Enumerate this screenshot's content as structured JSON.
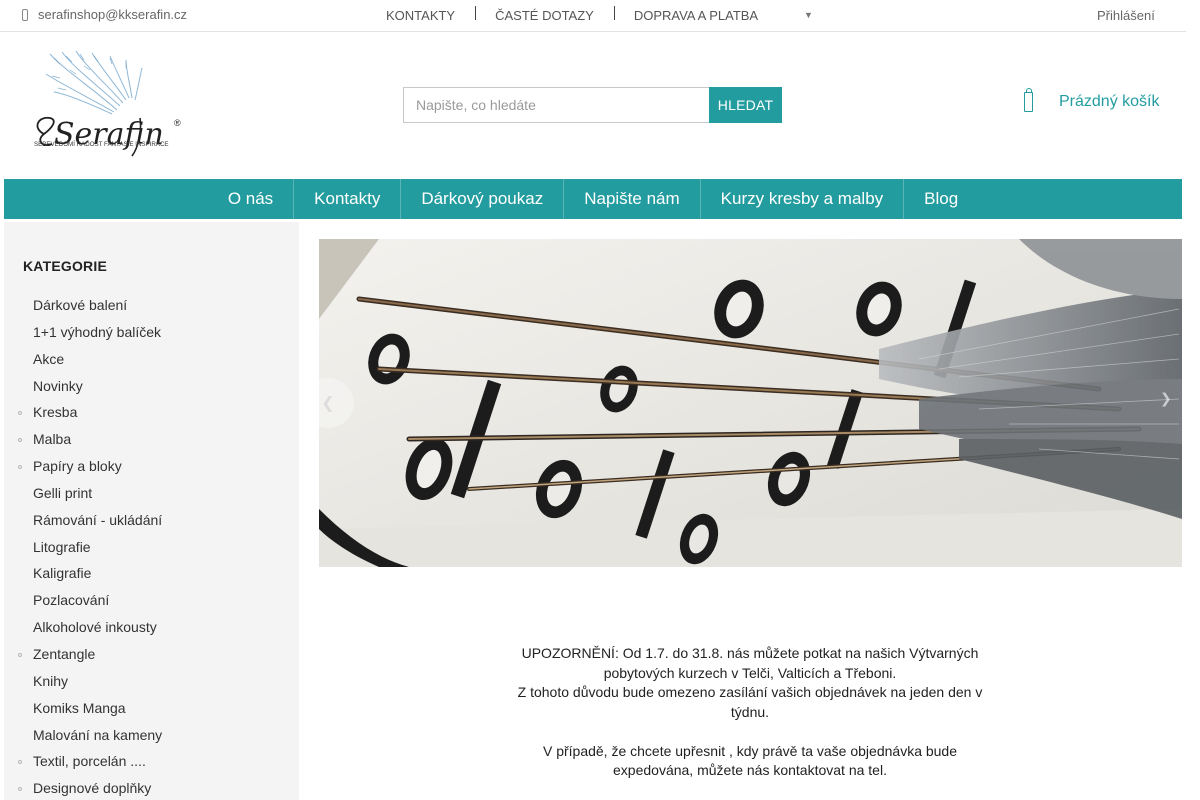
{
  "topbar": {
    "email": "serafinshop@kkserafin.cz",
    "links": [
      "KONTAKTY",
      "ČASTÉ DOTAZY",
      "DOPRAVA A PLATBA"
    ],
    "login": "Přihlášení"
  },
  "logo": {
    "name": "Serafin",
    "tagline": "SEBEVĚDOMÍ RADOST FANTASIE INSPIRACE"
  },
  "search": {
    "placeholder": "Napište, co hledáte",
    "button": "HLEDAT"
  },
  "cart": {
    "label": "Prázdný košík"
  },
  "mainnav": [
    "O nás",
    "Kontakty",
    "Dárkový poukaz",
    "Napište nám",
    "Kurzy kresby a malby",
    "Blog"
  ],
  "sidebar": {
    "title": "KATEGORIE",
    "items": [
      {
        "label": "Dárkové balení",
        "has_children": false
      },
      {
        "label": "1+1 výhodný balíček",
        "has_children": false
      },
      {
        "label": "Akce",
        "has_children": false
      },
      {
        "label": "Novinky",
        "has_children": false
      },
      {
        "label": "Kresba",
        "has_children": true
      },
      {
        "label": "Malba",
        "has_children": true
      },
      {
        "label": "Papíry a bloky",
        "has_children": true
      },
      {
        "label": "Gelli print",
        "has_children": false
      },
      {
        "label": "Rámování - ukládání",
        "has_children": false
      },
      {
        "label": "Litografie",
        "has_children": false
      },
      {
        "label": "Kaligrafie",
        "has_children": false
      },
      {
        "label": "Pozlacování",
        "has_children": false
      },
      {
        "label": "Alkoholové inkousty",
        "has_children": false
      },
      {
        "label": "Zentangle",
        "has_children": true
      },
      {
        "label": "Knihy",
        "has_children": false
      },
      {
        "label": "Komiks Manga",
        "has_children": false
      },
      {
        "label": "Malování na kameny",
        "has_children": false
      },
      {
        "label": "Textil, porcelán ....",
        "has_children": true
      },
      {
        "label": "Designové doplňky",
        "has_children": true
      }
    ]
  },
  "notice": {
    "lines": [
      "UPOZORNĚNÍ: Od 1.7. do 31.8. nás můžete potkat na našich Výtvarných pobytových kurzech v Telči, Valticích a Třeboni.",
      "Z tohoto důvodu bude omezeno zasílání vašich objednávek na jeden den v týdnu.",
      "",
      "V případě, že chcete upřesnit , kdy právě ta vaše objednávka bude expedována, můžete nás kontaktovat na tel."
    ]
  },
  "colors": {
    "accent": "#239ca0",
    "sidebar_bg": "#f4f4f4"
  }
}
